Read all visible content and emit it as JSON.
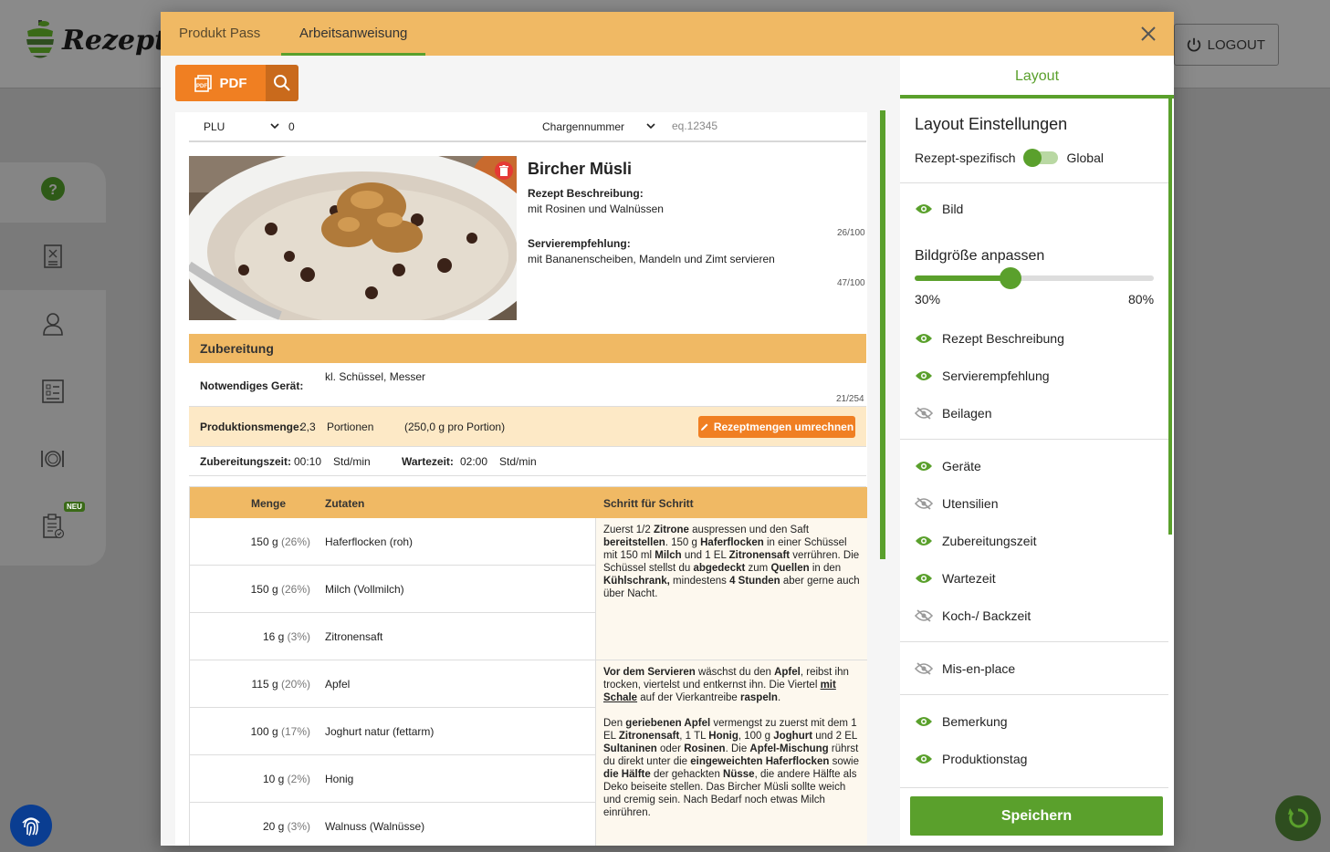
{
  "app": {
    "brand": "Rezeptrec",
    "logout_label": "LOGOUT",
    "neu_badge": "NEU"
  },
  "modal": {
    "tabs": [
      {
        "label": "Produkt Pass"
      },
      {
        "label": "Arbeitsanweisung"
      }
    ],
    "pdf_label": "PDF"
  },
  "doc": {
    "plu_label": "PLU",
    "plu_value": "0",
    "charge_label": "Chargennummer",
    "charge_placeholder": "eq.12345",
    "title": "Bircher Müsli",
    "desc_label": "Rezept Beschreibung:",
    "desc_value": "mit Rosinen und Walnüssen",
    "desc_counter": "26/100",
    "serv_label": "Servierempfehlung:",
    "serv_value": "mit Bananenscheiben, Mandeln und Zimt servieren",
    "serv_counter": "47/100",
    "zubereitung_title": "Zubereitung",
    "geraet_label": "Notwendiges Gerät:",
    "geraet_value": "kl. Schüssel, Messer",
    "geraet_counter": "21/254",
    "prod_label": "Produktionsmenge:",
    "prod_value": "2,3",
    "prod_unit": "Portionen",
    "prod_per": "(250,0 g pro Portion)",
    "umrechnen_label": "Rezeptmengen umrechnen",
    "zub_zeit_label": "Zubereitungszeit:",
    "zub_zeit_value": "00:10",
    "zub_zeit_unit": "Std/min",
    "warte_label": "Wartezeit:",
    "warte_value": "02:00",
    "warte_unit": "Std/min",
    "table_headers": {
      "menge": "Menge",
      "zutaten": "Zutaten",
      "schritt": "Schritt für Schritt"
    },
    "ingredients": [
      {
        "amount": "150 g",
        "pct": "(26%)",
        "name": "Haferflocken (roh)"
      },
      {
        "amount": "150 g",
        "pct": "(26%)",
        "name": "Milch (Vollmilch)"
      },
      {
        "amount": "16 g",
        "pct": "(3%)",
        "name": "Zitronensaft"
      },
      {
        "amount": "115 g",
        "pct": "(20%)",
        "name": "Apfel"
      },
      {
        "amount": "100 g",
        "pct": "(17%)",
        "name": "Joghurt natur (fettarm)"
      },
      {
        "amount": "10 g",
        "pct": "(2%)",
        "name": "Honig"
      },
      {
        "amount": "20 g",
        "pct": "(3%)",
        "name": "Walnuss (Walnüsse)"
      }
    ]
  },
  "layout_panel": {
    "tab_label": "Layout",
    "section_title": "Layout Einstellungen",
    "toggle_left": "Rezept-spezifisch",
    "toggle_right": "Global",
    "bildgroesse_label": "Bildgröße anpassen",
    "slider_min": "30%",
    "slider_max": "80%",
    "slider_value_fraction": 0.4,
    "options": [
      {
        "label": "Bild",
        "visible": true
      },
      {
        "label": "Rezept Beschreibung",
        "visible": true
      },
      {
        "label": "Servierempfehlung",
        "visible": true
      },
      {
        "label": "Beilagen",
        "visible": false
      },
      {
        "label": "Geräte",
        "visible": true
      },
      {
        "label": "Utensilien",
        "visible": false
      },
      {
        "label": "Zubereitungszeit",
        "visible": true
      },
      {
        "label": "Wartezeit",
        "visible": true
      },
      {
        "label": "Koch-/ Backzeit",
        "visible": false
      },
      {
        "label": "Mis-en-place",
        "visible": false
      },
      {
        "label": "Bemerkung",
        "visible": true
      },
      {
        "label": "Produktionstag",
        "visible": true
      }
    ],
    "save_label": "Speichern"
  },
  "colors": {
    "accent_green": "#5aa02c",
    "orange": "#f07f22",
    "tab_yellow": "#f0b964"
  }
}
